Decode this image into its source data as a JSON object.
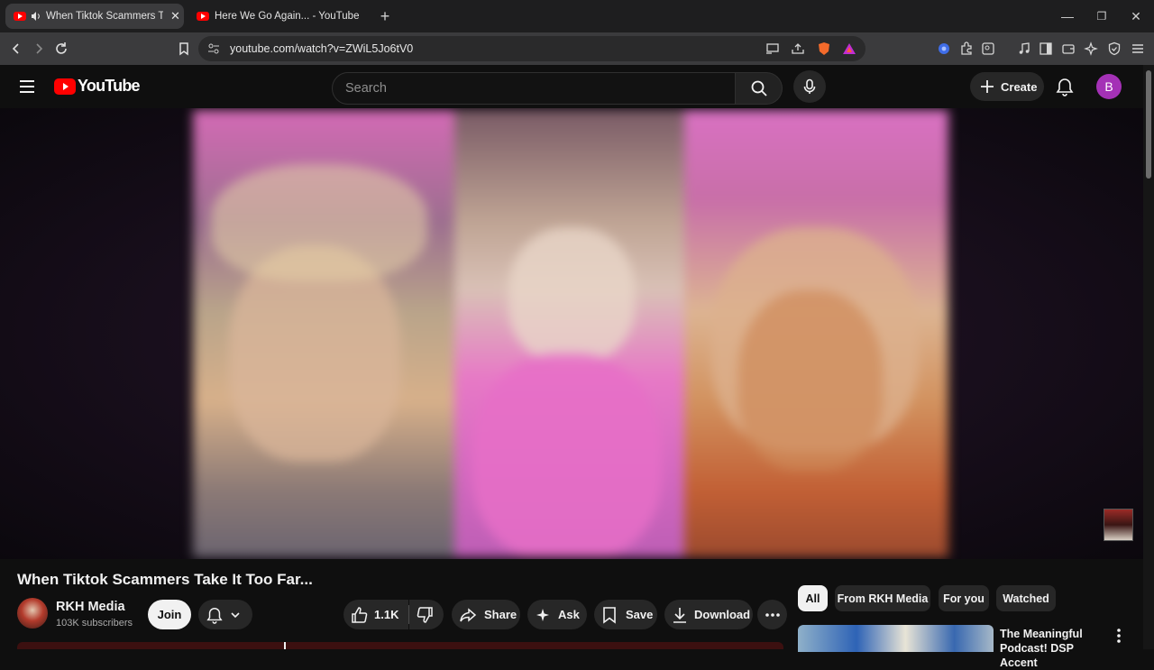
{
  "browser": {
    "tabs": [
      {
        "title": "When Tiktok Scammers Take It Too Far...",
        "display": "When Tiktok Scammers Take I",
        "active": true
      },
      {
        "title": "Here We Go Again... - YouTube",
        "display": "Here We Go Again... - YouTube",
        "active": false
      }
    ],
    "new_tab": "+",
    "url": "youtube.com/watch?v=ZWiL5Jo6tV0"
  },
  "youtube": {
    "logo_text": "YouTube",
    "search_placeholder": "Search",
    "create_label": "Create",
    "account_initial": "B"
  },
  "video": {
    "title": "When Tiktok Scammers Take It Too Far...",
    "channel": "RKH Media",
    "subscribers": "103K subscribers",
    "join_label": "Join",
    "likes": "1.1K",
    "share_label": "Share",
    "ask_label": "Ask",
    "save_label": "Save",
    "download_label": "Download"
  },
  "sidebar": {
    "chips": [
      {
        "label": "All",
        "selected": true
      },
      {
        "label": "From RKH Media",
        "selected": false
      },
      {
        "label": "For you",
        "selected": false
      },
      {
        "label": "Watched",
        "selected": false
      }
    ],
    "recommendation": {
      "title": "The Meaningful Podcast! DSP Accent"
    }
  },
  "colors": {
    "youtube_red": "#ff0000",
    "background": "#0f0f0f",
    "pill": "#272727",
    "avatar": "#a431b6"
  }
}
